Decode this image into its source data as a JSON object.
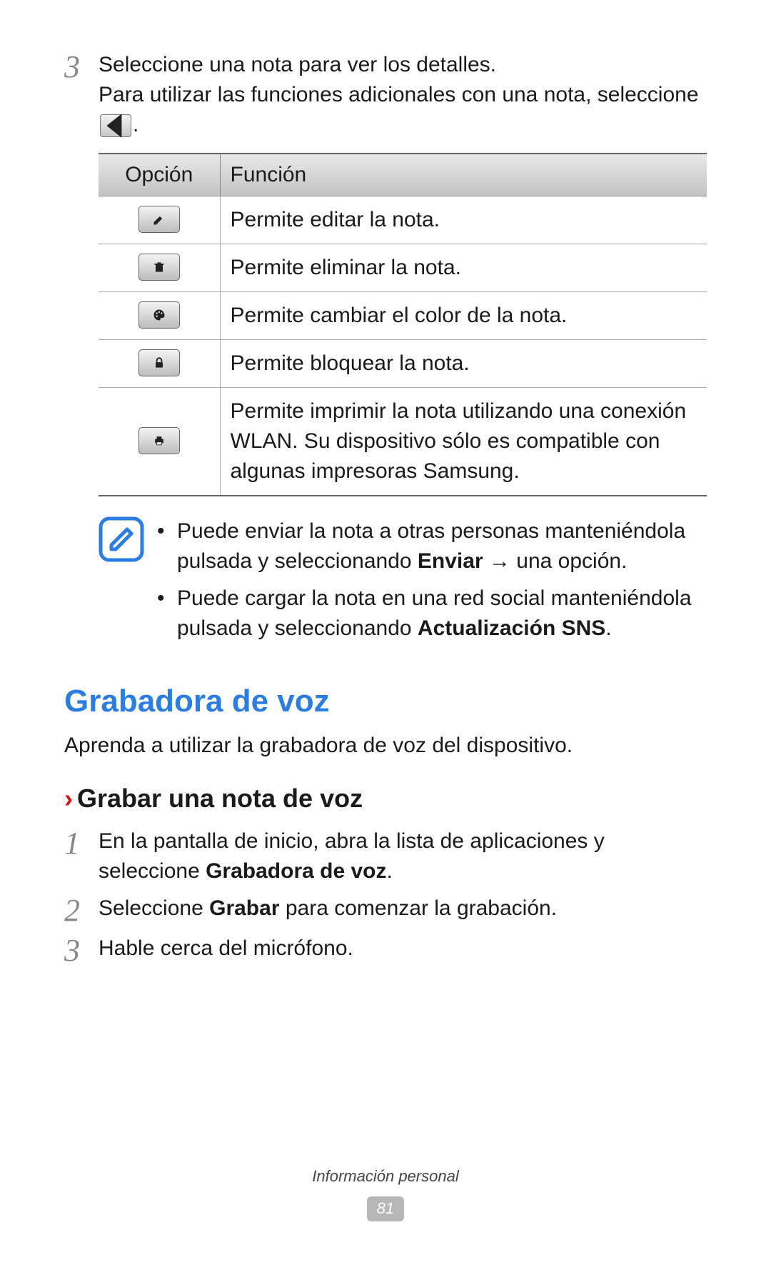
{
  "step3": {
    "num": "3",
    "line1": "Seleccione una nota para ver los detalles.",
    "line2a": "Para utilizar las funciones adicionales con una nota, seleccione ",
    "line2b": "."
  },
  "table": {
    "head_option": "Opción",
    "head_function": "Función",
    "rows": [
      {
        "icon": "edit-icon",
        "func": "Permite editar la nota."
      },
      {
        "icon": "delete-icon",
        "func": "Permite eliminar la nota."
      },
      {
        "icon": "palette-icon",
        "func": "Permite cambiar el color de la nota."
      },
      {
        "icon": "lock-icon",
        "func": "Permite bloquear la nota."
      },
      {
        "icon": "print-icon",
        "func": "Permite imprimir la nota utilizando una conexión WLAN. Su dispositivo sólo es compatible con algunas impresoras Samsung."
      }
    ]
  },
  "notes": {
    "item1_a": "Puede enviar la nota a otras personas manteniéndola pulsada y seleccionando ",
    "item1_bold": "Enviar",
    "item1_b": " → una opción.",
    "item2_a": "Puede cargar la nota en una red social manteniéndola pulsada y seleccionando ",
    "item2_bold": "Actualización SNS",
    "item2_b": "."
  },
  "section": {
    "title": "Grabadora de voz",
    "desc": "Aprenda a utilizar la grabadora de voz del dispositivo."
  },
  "sub": {
    "chev": "›",
    "title": "Grabar una nota de voz"
  },
  "steps2": {
    "s1_num": "1",
    "s1_a": "En la pantalla de inicio, abra la lista de aplicaciones y seleccione ",
    "s1_bold": "Grabadora de voz",
    "s1_b": ".",
    "s2_num": "2",
    "s2_a": "Seleccione ",
    "s2_bold": "Grabar",
    "s2_b": " para comenzar la grabación.",
    "s3_num": "3",
    "s3": "Hable cerca del micrófono."
  },
  "footer": {
    "label": "Información personal",
    "page": "81"
  }
}
